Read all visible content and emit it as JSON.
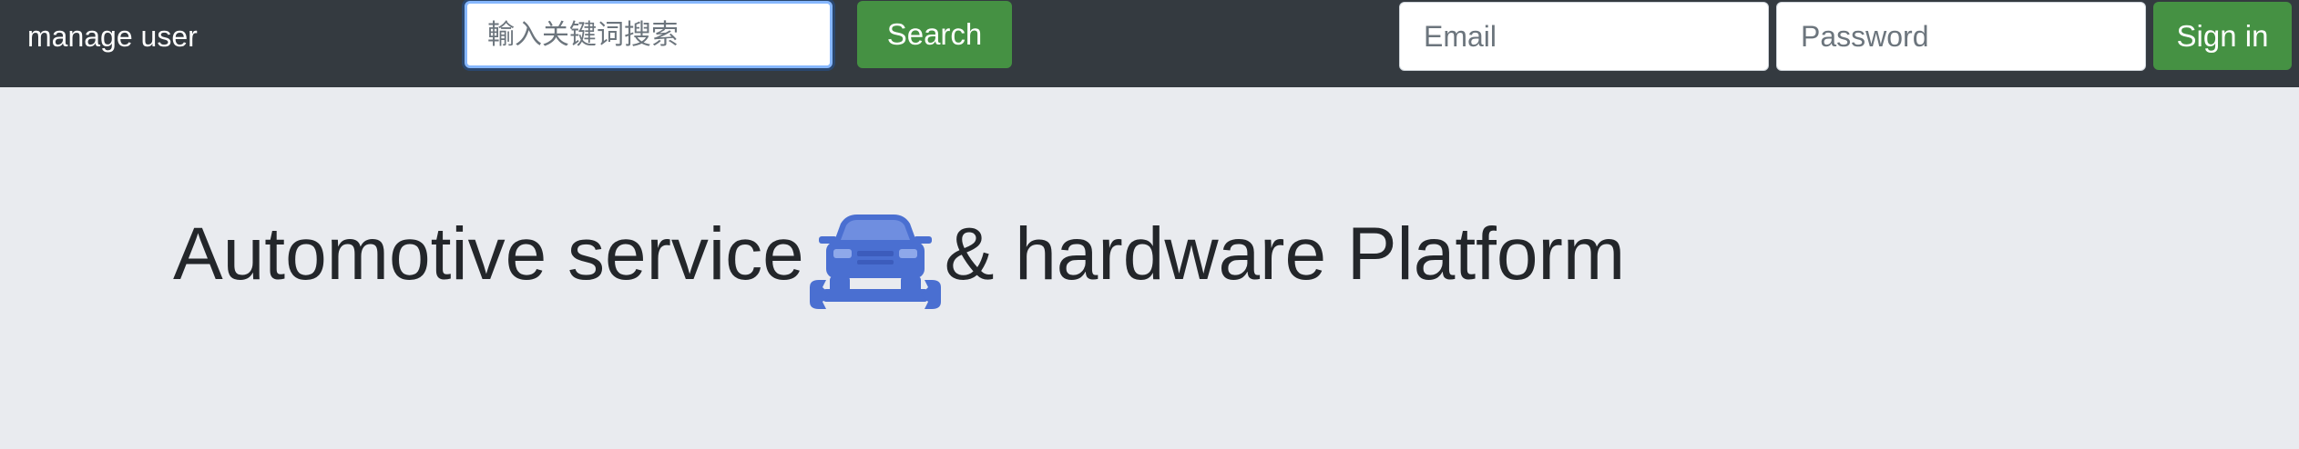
{
  "navbar": {
    "brand": "manage user",
    "search_placeholder": "輸入关键词搜索",
    "search_button": "Search",
    "email_placeholder": "Email",
    "password_placeholder": "Password",
    "signin_button": "Sign in"
  },
  "hero": {
    "title_part1": "Automotive service",
    "title_part2": "& hardware Platform",
    "icon": "car-wrench-icon"
  },
  "colors": {
    "navbar_bg": "#343a40",
    "page_bg": "#e9ebef",
    "button_green": "#459143",
    "icon_blue": "#4a6fd1",
    "input_focus_border": "#86b7fe"
  }
}
